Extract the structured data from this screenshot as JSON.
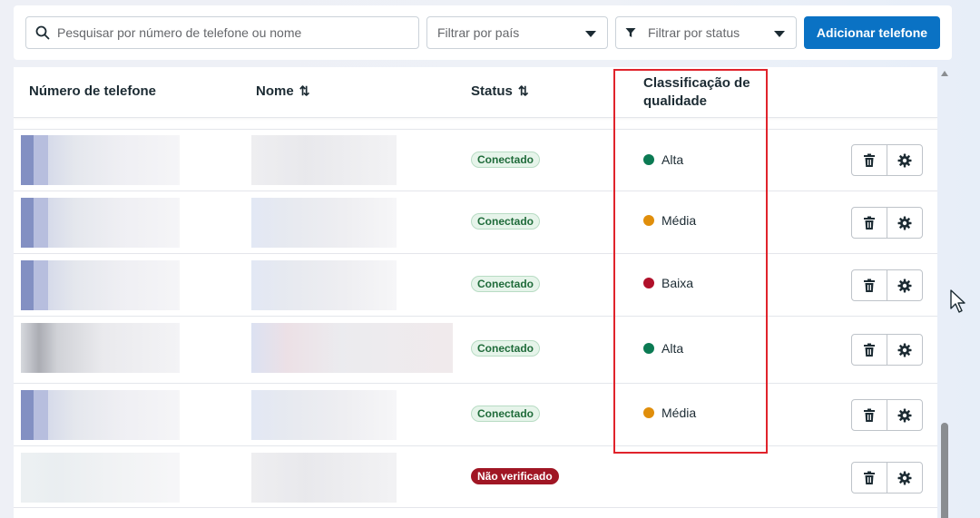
{
  "toolbar": {
    "search_placeholder": "Pesquisar por número de telefone ou nome",
    "country_filter": "Filtrar por país",
    "status_filter": "Filtrar por status",
    "add_button": "Adicionar telefone"
  },
  "table": {
    "headers": {
      "phone": "Número de telefone",
      "name": "Nome",
      "status": "Status",
      "quality": "Classificação de qualidade"
    },
    "rows": [
      {
        "status": "Conectado",
        "status_type": "connected",
        "quality": "Alta",
        "quality_color": "#0b7a53"
      },
      {
        "status": "Conectado",
        "status_type": "connected",
        "quality": "Média",
        "quality_color": "#e08e0b"
      },
      {
        "status": "Conectado",
        "status_type": "connected",
        "quality": "Baixa",
        "quality_color": "#b0102a"
      },
      {
        "status": "Conectado",
        "status_type": "connected",
        "quality": "Alta",
        "quality_color": "#0b7a53"
      },
      {
        "status": "Conectado",
        "status_type": "connected",
        "quality": "Média",
        "quality_color": "#e08e0b"
      },
      {
        "status": "Não verificado",
        "status_type": "unverified",
        "quality": "",
        "quality_color": ""
      }
    ]
  },
  "colors": {
    "accent": "#0a72c4",
    "highlight": "#e0232b",
    "connected_bg": "#e6f4ea",
    "unverified_bg": "#a01624"
  },
  "icons": {
    "search": "search-icon",
    "filter": "filter-icon",
    "caret": "caret-down-icon",
    "sort": "sort-icon",
    "delete": "trash-icon",
    "settings": "gear-icon"
  }
}
